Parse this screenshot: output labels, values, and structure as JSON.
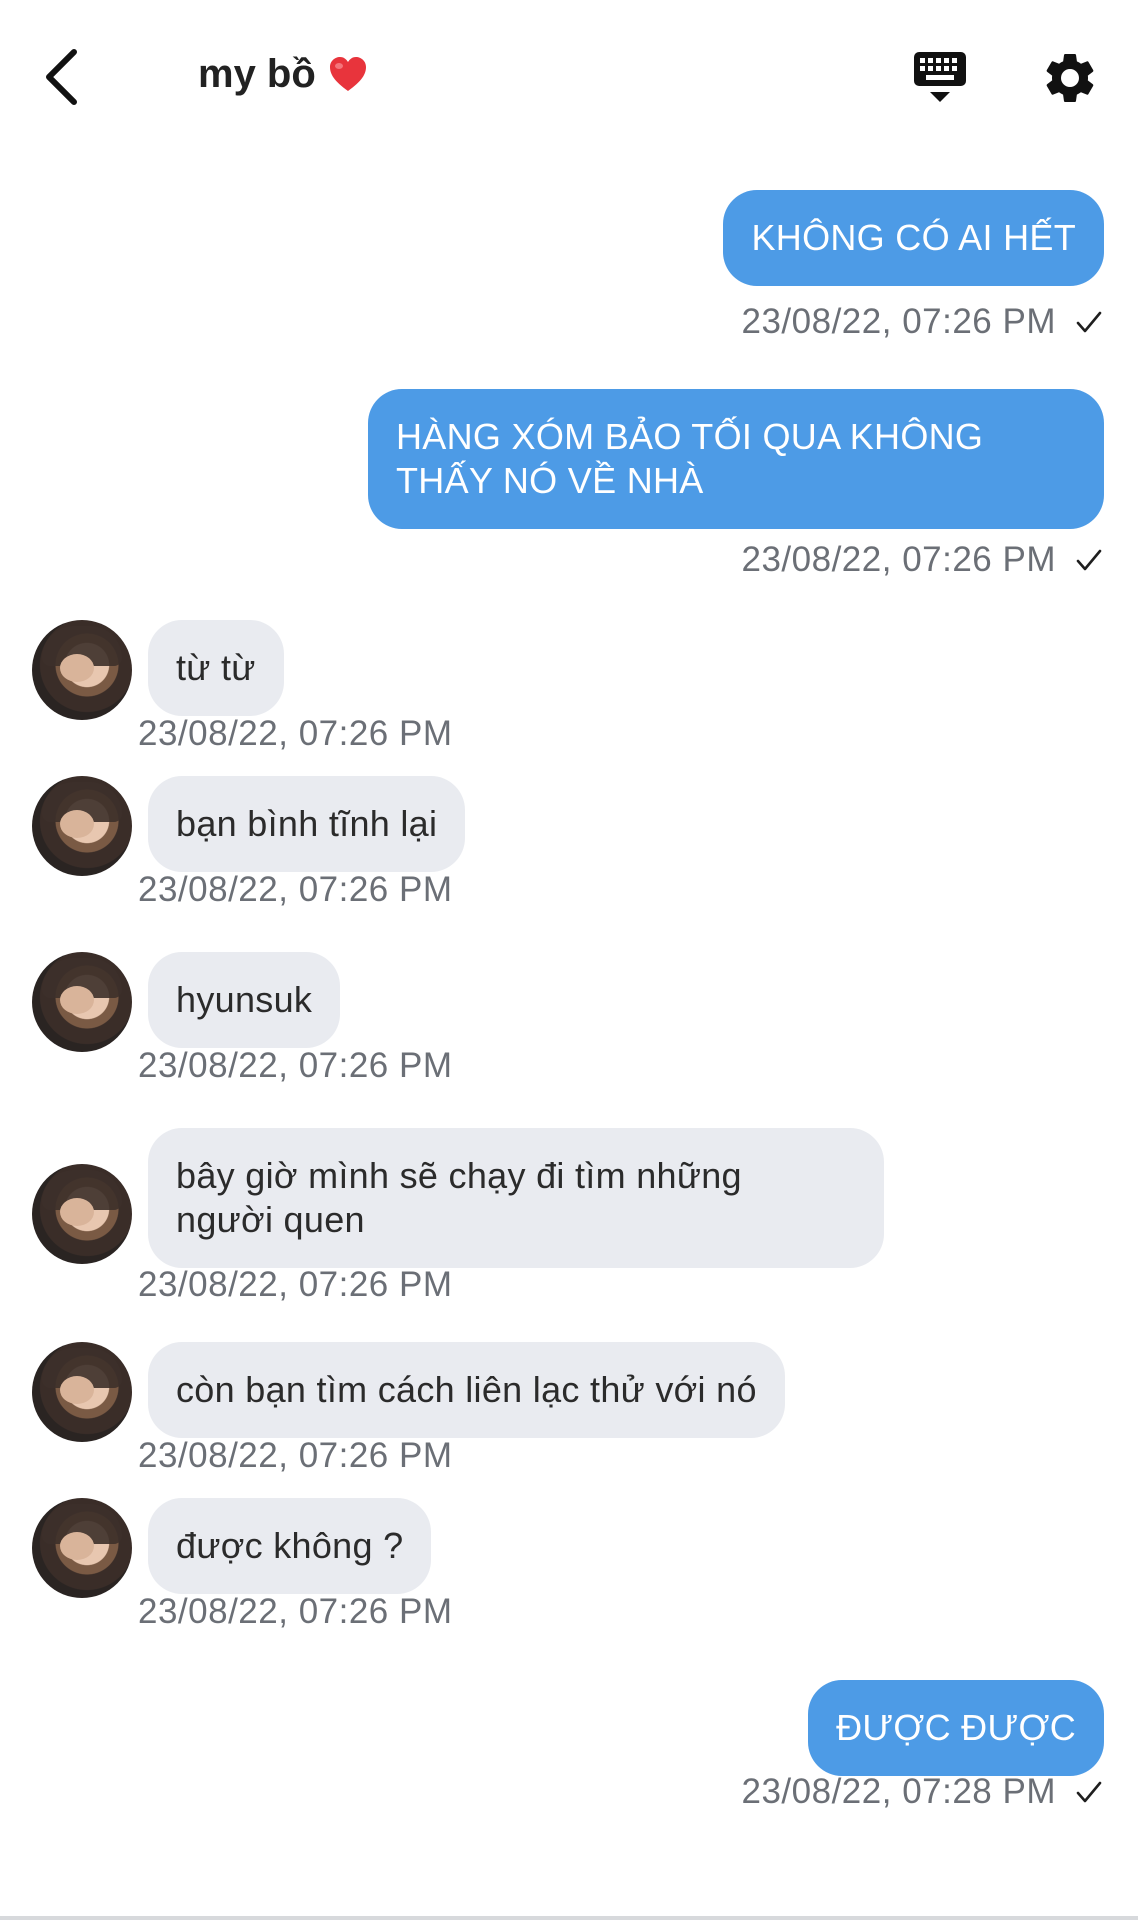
{
  "header": {
    "title": "my bồ",
    "title_emoji": "heart-icon"
  },
  "colors": {
    "outgoing_bubble": "#4d9be6",
    "incoming_bubble": "#e9ebf0",
    "timestamp": "#6b6f76"
  },
  "messages": [
    {
      "dir": "out",
      "text": "KHÔNG CÓ AI HẾT",
      "time": "23/08/22, 07:26 PM"
    },
    {
      "dir": "out",
      "text": "HÀNG XÓM BẢO TỐI QUA KHÔNG THẤY NÓ VỀ NHÀ",
      "line1": "HÀNG XÓM BẢO TỐI QUA KHÔNG",
      "line2": "THẤY NÓ VỀ NHÀ",
      "time": "23/08/22, 07:26 PM"
    },
    {
      "dir": "in",
      "text": "từ từ",
      "time": "23/08/22, 07:26 PM"
    },
    {
      "dir": "in",
      "text": "bạn bình tĩnh lại",
      "time": "23/08/22, 07:26 PM"
    },
    {
      "dir": "in",
      "text": "hyunsuk",
      "time": "23/08/22, 07:26 PM"
    },
    {
      "dir": "in",
      "text": "bây giờ mình sẽ chạy đi tìm những người quen",
      "line1": "bây giờ mình sẽ chạy đi tìm những",
      "line2": "người quen",
      "time": "23/08/22, 07:26 PM"
    },
    {
      "dir": "in",
      "text": "còn bạn tìm cách liên lạc thử với nó",
      "time": "23/08/22, 07:26 PM"
    },
    {
      "dir": "in",
      "text": "được không ?",
      "time": "23/08/22, 07:26 PM"
    },
    {
      "dir": "out",
      "text": "ĐƯỢC ĐƯỢC",
      "time": "23/08/22, 07:28 PM"
    }
  ]
}
